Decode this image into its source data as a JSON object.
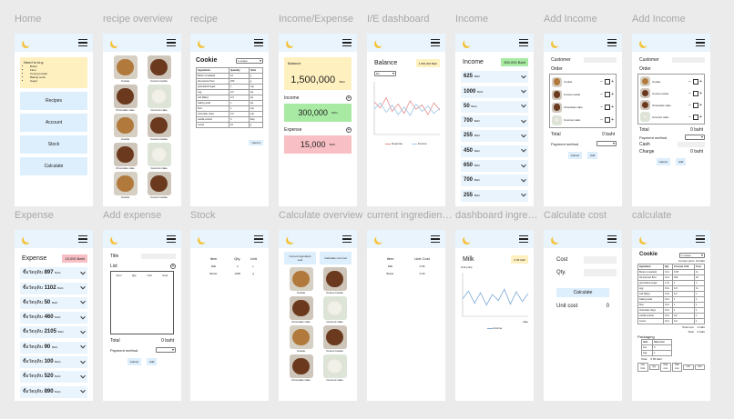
{
  "frames": {
    "home": {
      "title": "Home",
      "note_title": "Need to buy",
      "note_items": [
        "Butter",
        "Flour",
        "Cocoa powder",
        "Baking soda",
        "Sugar"
      ],
      "buttons": [
        "Recipes",
        "Account",
        "Stock",
        "Calculate"
      ]
    },
    "recipe_overview": {
      "title": "recipe overview",
      "items": [
        {
          "name": "Cookie",
          "img": "cookie"
        },
        {
          "name": "Cocoa Cookie",
          "img": "choco"
        },
        {
          "name": "Chocolate cake",
          "img": "choco"
        },
        {
          "name": "Coconut cake",
          "img": "coco"
        },
        {
          "name": "Cookie",
          "img": "cookie"
        },
        {
          "name": "Cocoa Cookie",
          "img": "choco"
        },
        {
          "name": "Chocolate cake",
          "img": "choco"
        },
        {
          "name": "Coconut cake",
          "img": "coco"
        },
        {
          "name": "Cookie",
          "img": "cookie"
        },
        {
          "name": "Cocoa Cookie",
          "img": "choco"
        }
      ]
    },
    "recipe": {
      "title": "recipe",
      "name": "Cookie",
      "select": "1 recipe",
      "headers": [
        "Ingredients",
        "Quantity",
        "Units"
      ],
      "rows": [
        [
          "Butter (unsalted)",
          "12",
          "g"
        ],
        [
          "all-purpose flour",
          "250",
          "g"
        ],
        [
          "granulated sugar",
          "1",
          "cup"
        ],
        [
          "egg",
          "1/2",
          "tsp"
        ],
        [
          "salt (flaky)",
          "1/4",
          "tsp"
        ],
        [
          "baking soda",
          "1",
          "tsp"
        ],
        [
          "flour",
          "1",
          "cup"
        ],
        [
          "chocolate chips",
          "1/2",
          "cup"
        ],
        [
          "vanilla extract",
          "4",
          "tbsp"
        ],
        [
          "cocoa",
          "10",
          "g"
        ]
      ],
      "button": "Used 1"
    },
    "income_expense": {
      "title": "Income/Expense",
      "balance_label": "Balance",
      "balance_value": "1,500,000",
      "balance_unit": "Baht",
      "income_label": "Income",
      "income_value": "300,000",
      "income_unit": "Baht",
      "expense_label": "Expense",
      "expense_value": "15,000",
      "expense_unit": "Baht"
    },
    "ie_dashboard": {
      "title": "I/E dashboard",
      "label": "Balance",
      "badge": "1,500,000 Baht",
      "select": "D1",
      "legend": [
        "Expense",
        "Income"
      ]
    },
    "income": {
      "title": "Income",
      "label": "Income",
      "badge": "300,000 Baht",
      "unit": "Baht",
      "items": [
        "625",
        "1000",
        "50",
        "700",
        "255",
        "450",
        "650",
        "700",
        "255"
      ]
    },
    "add_income_1": {
      "title": "Add Income",
      "customer": "Customer",
      "order": "Order",
      "products": [
        "Cookie",
        "Cocoa cookie",
        "Chocolate cake",
        "Coconut cake"
      ],
      "total_label": "Total",
      "total_value": "0 baht",
      "payment": "Payment method",
      "cancel": "Cancel",
      "add": "Add"
    },
    "add_income_2": {
      "title": "Add Income",
      "customer": "Customer",
      "order": "Order",
      "products": [
        "Cookie",
        "Cocoa cookie",
        "Chocolate cake",
        "Coconut cake"
      ],
      "total_label": "Total",
      "total_value": "0 baht",
      "payment": "Payment method",
      "cash": "Cash",
      "charge": "Charge",
      "charge_value": "0 baht",
      "cancel": "Cancel",
      "add": "Add"
    },
    "expense": {
      "title": "Expense",
      "label": "Expense",
      "badge": "15,000 Baht",
      "unit": "Baht",
      "item_name": "ซื้อวัตถุดิบ",
      "items": [
        "897",
        "1102",
        "50",
        "460",
        "2105",
        "90",
        "100",
        "520",
        "890"
      ]
    },
    "add_expense": {
      "title": "Add expense",
      "title_label": "Title",
      "list_label": "List",
      "cols": [
        "Item",
        "Qty.",
        "Unit",
        "Cost"
      ],
      "total_label": "Total",
      "total_value": "0 baht",
      "payment": "Payment method",
      "cancel": "Cancel",
      "add": "Add"
    },
    "stock": {
      "title": "Stock",
      "headers": [
        "Item",
        "Qty.",
        "Unit"
      ],
      "rows": [
        [
          "Milk",
          "3",
          "L"
        ],
        [
          "Butter",
          "1000",
          "g"
        ]
      ]
    },
    "calculate_overview": {
      "title": "Calculate overview",
      "btn1": "Current ingredient cost",
      "btn2": "Calculate unit cost",
      "items": [
        {
          "name": "Cookie",
          "img": "cookie"
        },
        {
          "name": "Cocoa Cookie",
          "img": "choco"
        },
        {
          "name": "Chocolate cake",
          "img": "choco"
        },
        {
          "name": "Coconut cake",
          "img": "coco"
        },
        {
          "name": "Cookie",
          "img": "cookie"
        },
        {
          "name": "Cocoa Cookie",
          "img": "choco"
        },
        {
          "name": "Chocolate cake",
          "img": "choco"
        },
        {
          "name": "Coconut cake",
          "img": "coco"
        }
      ]
    },
    "current_ingredient": {
      "title": "current ingredient cost",
      "headers": [
        "Item",
        "Unit Cost"
      ],
      "rows": [
        [
          "Milk",
          "0.05"
        ],
        [
          "Butter",
          "0.40"
        ]
      ]
    },
    "dashboard_ingredient": {
      "title": "dashboard ingredient",
      "label": "Milk",
      "badge": "0.05 baht",
      "axis_y": "Unit price",
      "axis_x": "date",
      "legend": "Income"
    },
    "calculate_cost": {
      "title": "Calculate cost",
      "cost": "Cost",
      "qty": "Qty.",
      "button": "Calculate",
      "unit_cost": "Unit cost",
      "unit_value": "0"
    },
    "calculate": {
      "title": "calculate",
      "name": "Cookie",
      "select": "1 recipe",
      "current_price": "Current price: 10 baht",
      "headers": [
        "Ingredient",
        "Qty",
        "Cost per Unit",
        "Cost"
      ],
      "rows": [
        [
          "Butter (unsalted)",
          "0.11",
          "0.05",
          "11"
        ],
        [
          "All-purpose flour",
          "0.11",
          "200",
          "22"
        ],
        [
          "granulated sugar",
          "1.01",
          "1",
          "1"
        ],
        [
          "egg",
          "0.11",
          "1/4",
          "11"
        ],
        [
          "salt (flaky)",
          "0.01",
          "1/2",
          "1"
        ],
        [
          "baking soda",
          "0.11",
          "1",
          "1"
        ],
        [
          "flour",
          "0.11",
          "1",
          "1"
        ],
        [
          "chocolate chips",
          "0.11",
          "1",
          "1"
        ],
        [
          "vanilla extract",
          "0.11",
          "1/2",
          "1"
        ],
        [
          "cocoa",
          "0.11",
          "1/2",
          "1"
        ]
      ],
      "total_cost": "Total cost",
      "total_cost_value": "4 baht",
      "total": "Total",
      "total_value": "0 baht",
      "packaging": "Packaging",
      "pkg_headers": [
        "item",
        "Item cost"
      ],
      "pkg_rows": [
        [
          "box",
          "5"
        ],
        [
          "bag",
          "1"
        ]
      ],
      "pkg_total": "Total",
      "pkg_total_value": "0.55 baht",
      "footer": [
        "Unit Cost",
        "Qty",
        "Total cost",
        "Total cost",
        "Unit",
        "Unit"
      ]
    }
  },
  "charts": {
    "ie_dashboard": {
      "type": "line",
      "series": [
        {
          "values": [
            62,
            50,
            70,
            44,
            58,
            40,
            64,
            48,
            56,
            38,
            60,
            46
          ],
          "color": "#e58b8b"
        },
        {
          "values": [
            48,
            60,
            42,
            56,
            38,
            52,
            36,
            58,
            44,
            54,
            40,
            50
          ],
          "color": "#9fc6e6"
        }
      ],
      "ylim": [
        0,
        100
      ]
    },
    "dashboard_ingredient": {
      "type": "line",
      "series": [
        {
          "values": [
            40,
            58,
            30,
            54,
            26,
            50,
            36,
            62,
            28,
            56,
            34,
            52
          ],
          "color": "#7aa9d6"
        }
      ],
      "ylim": [
        0,
        100
      ]
    }
  }
}
